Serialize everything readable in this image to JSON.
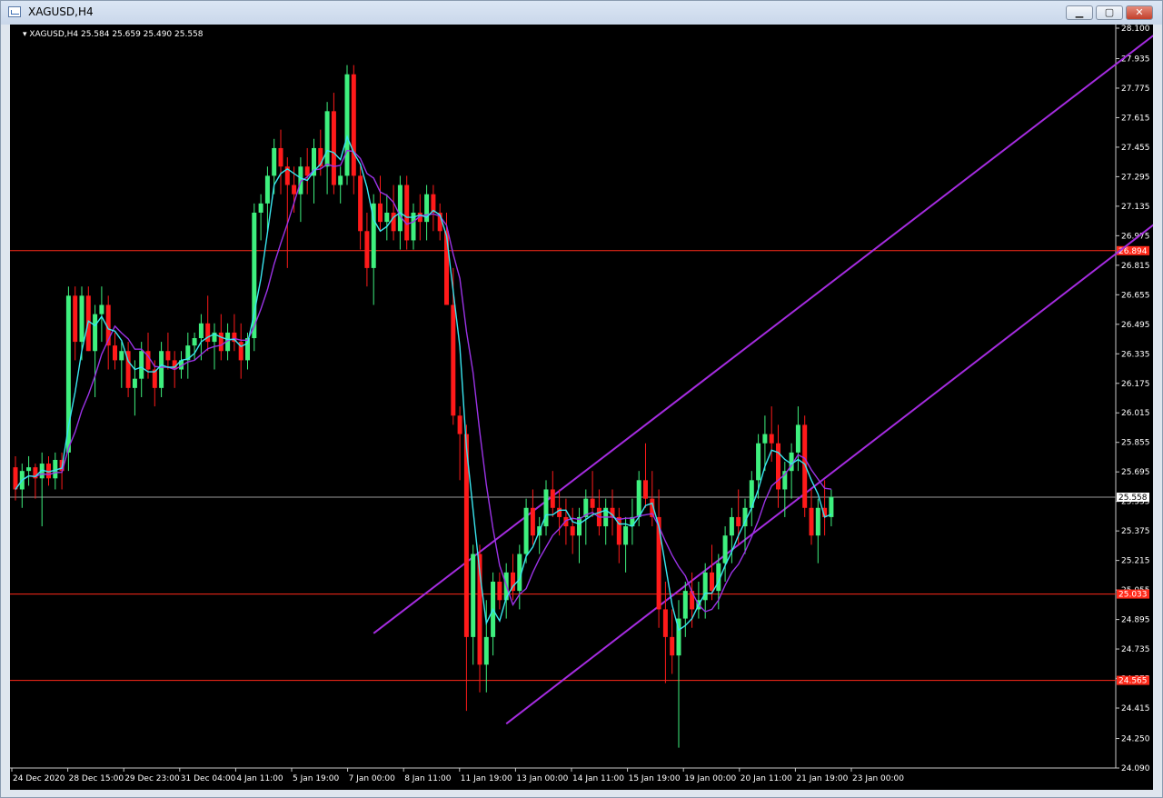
{
  "window": {
    "title": "XAGUSD,H4",
    "minimize_label": "▁",
    "maximize_label": "▢",
    "close_label": "✕"
  },
  "chart_data": {
    "type": "candlestick",
    "symbol_info": "XAGUSD,H4  25.584 25.659 25.490 25.558",
    "ylim": [
      24.09,
      28.1
    ],
    "y_ticks": [
      "28.100",
      "27.935",
      "27.775",
      "27.615",
      "27.455",
      "27.295",
      "27.135",
      "26.975",
      "26.815",
      "26.655",
      "26.495",
      "26.335",
      "26.175",
      "26.015",
      "25.855",
      "25.695",
      "25.535",
      "25.375",
      "25.215",
      "25.055",
      "24.895",
      "24.735",
      "24.575",
      "24.415",
      "24.250",
      "24.090"
    ],
    "x_labels": [
      "24 Dec 2020",
      "28 Dec 15:00",
      "29 Dec 23:00",
      "31 Dec 04:00",
      "4 Jan 11:00",
      "5 Jan 19:00",
      "7 Jan 00:00",
      "8 Jan 11:00",
      "11 Jan 19:00",
      "13 Jan 00:00",
      "14 Jan 11:00",
      "15 Jan 19:00",
      "19 Jan 00:00",
      "20 Jan 11:00",
      "21 Jan 19:00",
      "23 Jan 00:00"
    ],
    "horizontal_lines": [
      {
        "price": 26.894,
        "label": "26.894",
        "color": "#ff2a1a"
      },
      {
        "price": 25.033,
        "label": "25.033",
        "color": "#ff2a1a"
      },
      {
        "price": 24.565,
        "label": "24.565",
        "color": "#ff2a1a"
      }
    ],
    "current_price": {
      "price": 25.558,
      "label": "25.558"
    },
    "colors": {
      "bull": "#3ef07e",
      "bear": "#ff1a1a",
      "ma_fast": "#39e6f0",
      "ma_slow": "#9b33e6",
      "channel": "#a52ce0"
    },
    "channel_lines": [
      {
        "from": {
          "bar": 54,
          "price": 24.82
        },
        "to": {
          "bar": 173,
          "price": 28.1
        }
      },
      {
        "from": {
          "bar": 74,
          "price": 24.33
        },
        "to": {
          "bar": 192,
          "price": 27.6
        }
      }
    ],
    "ohlc": [
      [
        25.72,
        25.78,
        25.54,
        25.6
      ],
      [
        25.6,
        25.74,
        25.5,
        25.7
      ],
      [
        25.7,
        25.78,
        25.62,
        25.72
      ],
      [
        25.72,
        25.74,
        25.55,
        25.66
      ],
      [
        25.66,
        25.8,
        25.4,
        25.74
      ],
      [
        25.74,
        25.78,
        25.62,
        25.66
      ],
      [
        25.66,
        25.8,
        25.6,
        25.76
      ],
      [
        25.76,
        25.8,
        25.6,
        25.7
      ],
      [
        25.8,
        26.7,
        25.7,
        26.65
      ],
      [
        26.65,
        26.7,
        26.3,
        26.4
      ],
      [
        26.4,
        26.7,
        26.3,
        26.65
      ],
      [
        26.65,
        26.7,
        26.35,
        26.35
      ],
      [
        26.35,
        26.6,
        26.1,
        26.55
      ],
      [
        26.55,
        26.7,
        26.4,
        26.6
      ],
      [
        26.6,
        26.65,
        26.25,
        26.38
      ],
      [
        26.38,
        26.45,
        26.25,
        26.3
      ],
      [
        26.3,
        26.4,
        26.15,
        26.35
      ],
      [
        26.35,
        26.4,
        26.1,
        26.15
      ],
      [
        26.15,
        26.3,
        26.0,
        26.2
      ],
      [
        26.2,
        26.4,
        26.1,
        26.35
      ],
      [
        26.35,
        26.45,
        26.2,
        26.25
      ],
      [
        26.25,
        26.3,
        26.05,
        26.15
      ],
      [
        26.15,
        26.4,
        26.1,
        26.35
      ],
      [
        26.35,
        26.45,
        26.25,
        26.3
      ],
      [
        26.3,
        26.35,
        26.15,
        26.25
      ],
      [
        26.25,
        26.35,
        26.2,
        26.3
      ],
      [
        26.3,
        26.45,
        26.2,
        26.38
      ],
      [
        26.38,
        26.45,
        26.3,
        26.42
      ],
      [
        26.42,
        26.55,
        26.3,
        26.5
      ],
      [
        26.5,
        26.65,
        26.35,
        26.4
      ],
      [
        26.4,
        26.5,
        26.25,
        26.45
      ],
      [
        26.45,
        26.55,
        26.3,
        26.35
      ],
      [
        26.35,
        26.5,
        26.3,
        26.45
      ],
      [
        26.45,
        26.55,
        26.35,
        26.4
      ],
      [
        26.4,
        26.5,
        26.2,
        26.3
      ],
      [
        26.3,
        26.45,
        26.25,
        26.42
      ],
      [
        26.42,
        27.15,
        26.35,
        27.1
      ],
      [
        27.1,
        27.2,
        26.95,
        27.15
      ],
      [
        27.15,
        27.35,
        27.0,
        27.3
      ],
      [
        27.3,
        27.5,
        27.2,
        27.45
      ],
      [
        27.45,
        27.55,
        27.2,
        27.35
      ],
      [
        27.35,
        27.4,
        26.8,
        27.25
      ],
      [
        27.25,
        27.35,
        27.1,
        27.2
      ],
      [
        27.2,
        27.4,
        27.05,
        27.35
      ],
      [
        27.35,
        27.45,
        27.2,
        27.3
      ],
      [
        27.3,
        27.5,
        27.15,
        27.45
      ],
      [
        27.45,
        27.55,
        27.3,
        27.35
      ],
      [
        27.35,
        27.7,
        27.2,
        27.65
      ],
      [
        27.65,
        27.75,
        27.2,
        27.25
      ],
      [
        27.25,
        27.35,
        27.15,
        27.3
      ],
      [
        27.3,
        27.9,
        27.25,
        27.85
      ],
      [
        27.85,
        27.9,
        27.2,
        27.3
      ],
      [
        27.3,
        27.35,
        26.9,
        27.0
      ],
      [
        27.0,
        27.1,
        26.7,
        26.8
      ],
      [
        26.8,
        27.2,
        26.6,
        27.15
      ],
      [
        27.15,
        27.3,
        27.0,
        27.05
      ],
      [
        27.05,
        27.2,
        26.95,
        27.1
      ],
      [
        27.1,
        27.25,
        26.95,
        27.0
      ],
      [
        27.0,
        27.3,
        26.9,
        27.25
      ],
      [
        27.25,
        27.3,
        26.9,
        26.95
      ],
      [
        26.95,
        27.15,
        26.9,
        27.1
      ],
      [
        27.1,
        27.2,
        26.95,
        27.05
      ],
      [
        27.05,
        27.25,
        26.95,
        27.2
      ],
      [
        27.2,
        27.25,
        27.0,
        27.1
      ],
      [
        27.1,
        27.15,
        26.95,
        27.0
      ],
      [
        27.0,
        27.1,
        26.6,
        26.6
      ],
      [
        26.6,
        26.8,
        25.95,
        26.0
      ],
      [
        26.0,
        26.05,
        25.65,
        25.9
      ],
      [
        25.9,
        25.95,
        24.4,
        24.8
      ],
      [
        24.8,
        25.3,
        24.65,
        25.25
      ],
      [
        25.25,
        25.3,
        24.5,
        24.65
      ],
      [
        24.65,
        25.0,
        24.5,
        24.8
      ],
      [
        24.8,
        25.15,
        24.7,
        25.1
      ],
      [
        25.1,
        25.15,
        24.95,
        25.0
      ],
      [
        25.0,
        25.2,
        24.9,
        25.15
      ],
      [
        25.15,
        25.25,
        25.0,
        25.05
      ],
      [
        25.05,
        25.3,
        24.95,
        25.25
      ],
      [
        25.25,
        25.55,
        25.2,
        25.5
      ],
      [
        25.5,
        25.6,
        25.3,
        25.35
      ],
      [
        25.35,
        25.45,
        25.25,
        25.4
      ],
      [
        25.4,
        25.65,
        25.35,
        25.6
      ],
      [
        25.6,
        25.7,
        25.45,
        25.5
      ],
      [
        25.5,
        25.6,
        25.35,
        25.45
      ],
      [
        25.45,
        25.55,
        25.3,
        25.4
      ],
      [
        25.4,
        25.5,
        25.25,
        25.35
      ],
      [
        25.35,
        25.5,
        25.2,
        25.45
      ],
      [
        25.45,
        25.6,
        25.3,
        25.55
      ],
      [
        25.55,
        25.7,
        25.45,
        25.5
      ],
      [
        25.5,
        25.6,
        25.35,
        25.4
      ],
      [
        25.4,
        25.55,
        25.3,
        25.5
      ],
      [
        25.5,
        25.6,
        25.35,
        25.45
      ],
      [
        25.45,
        25.5,
        25.2,
        25.3
      ],
      [
        25.3,
        25.45,
        25.15,
        25.4
      ],
      [
        25.4,
        25.55,
        25.3,
        25.45
      ],
      [
        25.45,
        25.7,
        25.4,
        25.65
      ],
      [
        25.65,
        25.85,
        25.5,
        25.55
      ],
      [
        25.55,
        25.7,
        25.4,
        25.45
      ],
      [
        25.45,
        25.6,
        24.85,
        24.95
      ],
      [
        24.95,
        25.1,
        24.55,
        24.8
      ],
      [
        24.8,
        24.95,
        24.6,
        24.7
      ],
      [
        24.7,
        25.0,
        24.2,
        24.9
      ],
      [
        24.9,
        25.1,
        24.8,
        25.05
      ],
      [
        25.05,
        25.15,
        24.85,
        24.95
      ],
      [
        24.95,
        25.1,
        24.9,
        25.0
      ],
      [
        25.0,
        25.2,
        24.9,
        25.15
      ],
      [
        25.15,
        25.3,
        25.0,
        25.05
      ],
      [
        25.05,
        25.25,
        24.95,
        25.2
      ],
      [
        25.2,
        25.4,
        25.1,
        25.35
      ],
      [
        25.35,
        25.5,
        25.2,
        25.45
      ],
      [
        25.45,
        25.6,
        25.3,
        25.4
      ],
      [
        25.4,
        25.55,
        25.25,
        25.5
      ],
      [
        25.5,
        25.7,
        25.4,
        25.65
      ],
      [
        25.65,
        25.9,
        25.55,
        25.85
      ],
      [
        25.85,
        26.0,
        25.7,
        25.9
      ],
      [
        25.9,
        26.05,
        25.75,
        25.85
      ],
      [
        25.85,
        25.95,
        25.5,
        25.6
      ],
      [
        25.6,
        25.75,
        25.45,
        25.7
      ],
      [
        25.7,
        25.85,
        25.55,
        25.8
      ],
      [
        25.8,
        26.05,
        25.7,
        25.95
      ],
      [
        25.95,
        26.0,
        25.45,
        25.5
      ],
      [
        25.5,
        25.6,
        25.3,
        25.35
      ],
      [
        25.35,
        25.55,
        25.2,
        25.5
      ],
      [
        25.5,
        25.65,
        25.35,
        25.45
      ],
      [
        25.45,
        25.6,
        25.4,
        25.56
      ]
    ]
  }
}
